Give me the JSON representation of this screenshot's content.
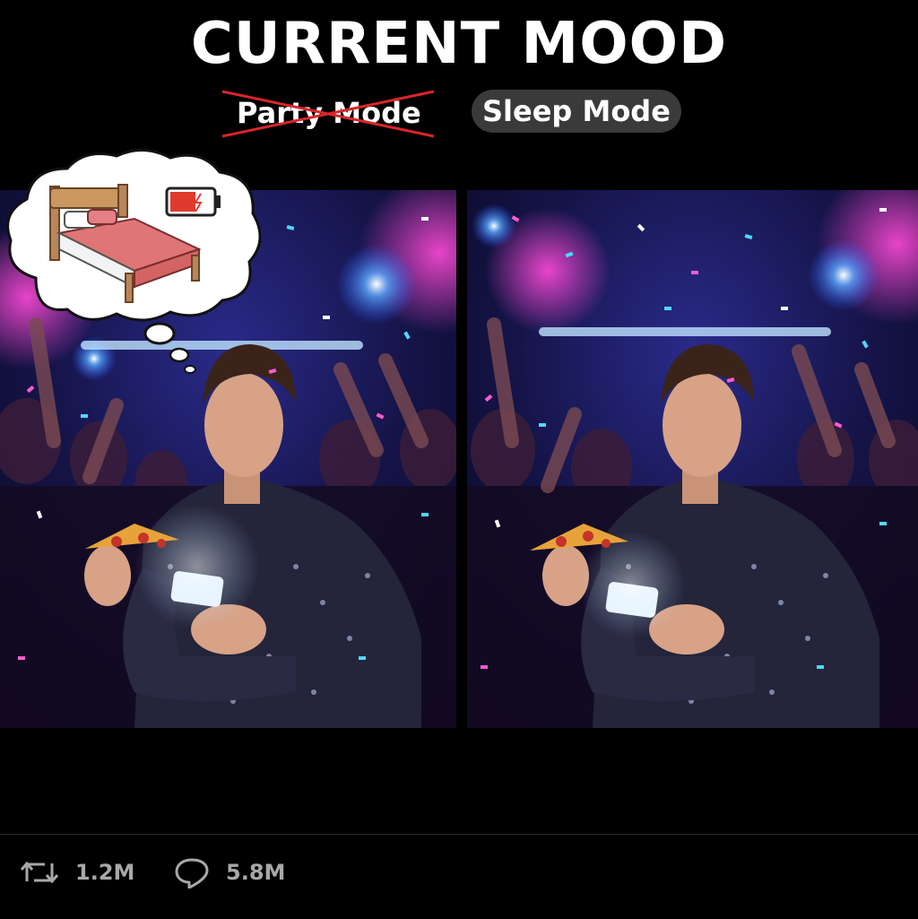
{
  "title": "CURRENT MOOD",
  "modes": {
    "crossed_out": "Party Mode",
    "active": "Sleep Mode"
  },
  "thought_bubble": {
    "icons": [
      "bed-icon",
      "low-battery-icon"
    ]
  },
  "actions": {
    "retweet": {
      "icon": "retweet-icon",
      "count": "1.2M"
    },
    "reply": {
      "icon": "reply-icon",
      "count": "5.8M"
    }
  },
  "colors": {
    "background": "#000000",
    "strike": "#d9252a",
    "pill": "#3a3a3a",
    "action_text": "#a8a8a8",
    "battery": "#e03a2f"
  }
}
